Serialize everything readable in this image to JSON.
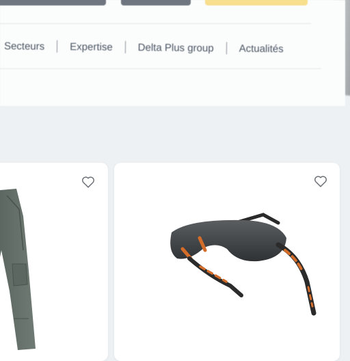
{
  "nav": {
    "items": [
      "Secteurs",
      "Expertise",
      "Delta Plus group",
      "Actualités"
    ]
  },
  "colors": {
    "accent": "#f7df8e",
    "top_buttons": "#6f7680",
    "page_bg": "#eef1f3"
  },
  "products": [
    {
      "image": "work-trousers-image",
      "favorite_icon": "heart-icon"
    },
    {
      "image": "safety-glasses-image",
      "favorite_icon": "heart-icon"
    }
  ]
}
